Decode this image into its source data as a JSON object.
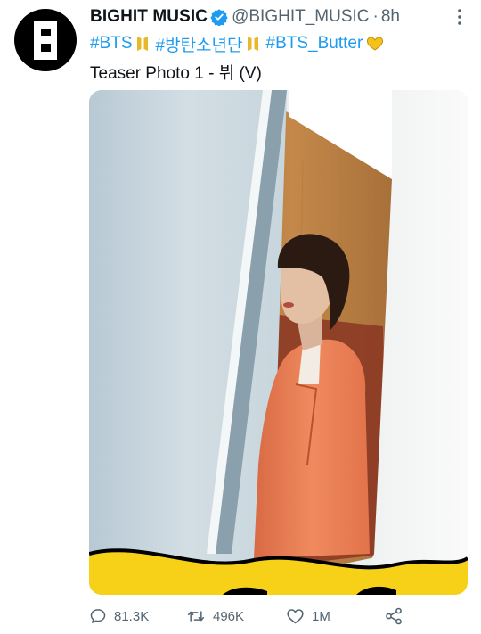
{
  "tweet": {
    "author": {
      "display_name": "BIGHIT MUSIC",
      "handle": "@BIGHIT_MUSIC",
      "separator": "·",
      "time_ago": "8h",
      "avatar_icon": "bighit-logo-icon",
      "verified_icon": "verified-badge-icon"
    },
    "text": {
      "hashtags": [
        "#BTS",
        "#방탄소년단",
        "#BTS_Butter"
      ],
      "hashtag_emojis": [
        "bts-logo-emoji",
        "bts-logo-emoji",
        "yellow-heart-emoji"
      ],
      "caption": "Teaser Photo 1 - 뷔 (V)"
    },
    "media": {
      "type": "photo",
      "description_icon": "teaser-photo"
    },
    "actions": {
      "reply_count": "81.3K",
      "retweet_count": "496K",
      "like_count": "1M",
      "reply_icon": "reply-icon",
      "retweet_icon": "retweet-icon",
      "like_icon": "heart-icon",
      "share_icon": "share-icon"
    },
    "more_icon": "more-icon"
  },
  "colors": {
    "link": "#1d9bf0",
    "secondary_text": "#536471",
    "butter_yellow": "#f7d117"
  }
}
